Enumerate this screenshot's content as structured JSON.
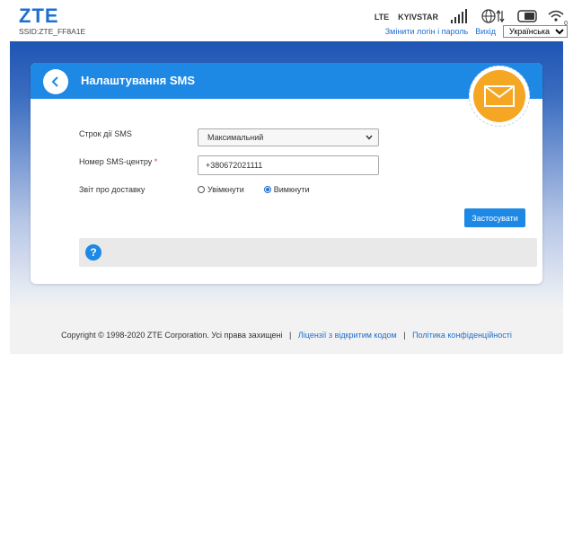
{
  "header": {
    "logo": "ZTE",
    "ssid": "SSID:ZTE_FF8A1E",
    "network_type": "LTE",
    "operator": "KYIVSTAR",
    "change_login_link": "Змінити логін і пароль",
    "logout_link": "Вихід",
    "language": "Українська",
    "sim_superscript": "0"
  },
  "page": {
    "title": "Налаштування SMS"
  },
  "form": {
    "validity_label": "Строк дії SMS",
    "validity_value": "Максимальний",
    "center_label": "Номер SMS-центру",
    "required_mark": "*",
    "center_value": "+380672021111",
    "delivery_label": "Звіт про доставку",
    "delivery_on": "Увімкнути",
    "delivery_off": "Вимкнути",
    "apply_button": "Застосувати"
  },
  "help": {
    "icon_text": "?"
  },
  "footer": {
    "copyright": "Copyright © 1998-2020 ZTE Corporation. Усі права захищені",
    "sep1": "|",
    "license_link": "Ліцензії з відкритим кодом",
    "sep2": "|",
    "privacy_link": "Політика конфіденційності"
  },
  "colors": {
    "accent": "#1e88e5",
    "mail": "#f5a623",
    "logo": "#1e6fd0"
  }
}
